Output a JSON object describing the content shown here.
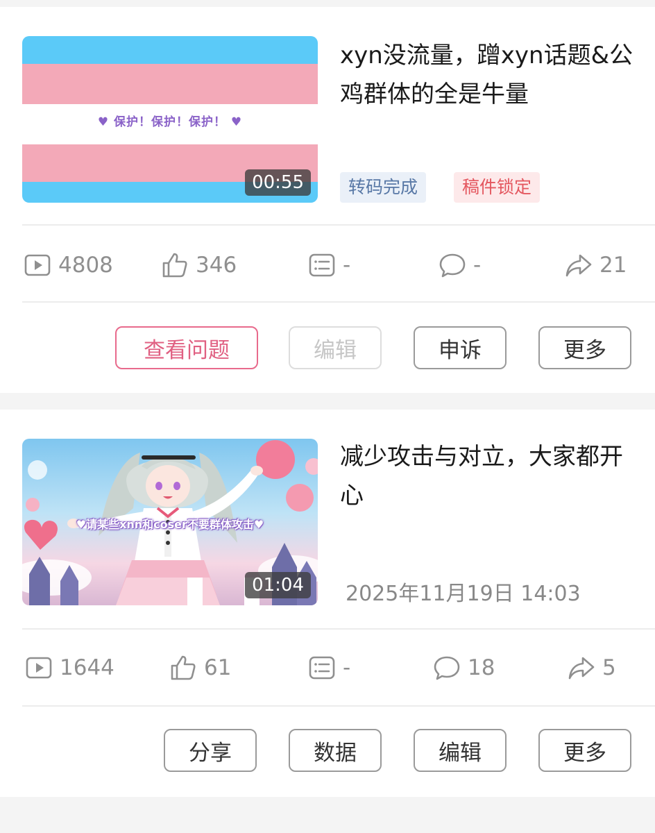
{
  "videos": [
    {
      "title": "xyn没流量，蹭xyn话题&公鸡群体的全是牛量",
      "thumbnail_caption": "♥ 保护！保护！保护！ ♥",
      "duration": "00:55",
      "tags": [
        "转码完成",
        "稿件锁定"
      ],
      "stats": {
        "plays": "4808",
        "likes": "346",
        "danmaku": "-",
        "comments": "-",
        "shares": "21"
      },
      "buttons": [
        "查看问题",
        "编辑",
        "申诉",
        "更多"
      ]
    },
    {
      "title": "减少攻击与对立，大家都开心",
      "thumbnail_caption": "♥请某些xnn和coser不要群体攻击♥",
      "duration": "01:04",
      "date": "2025年11月19日 14:03",
      "stats": {
        "plays": "1644",
        "likes": "61",
        "danmaku": "-",
        "comments": "18",
        "shares": "5"
      },
      "buttons": [
        "分享",
        "数据",
        "编辑",
        "更多"
      ]
    }
  ],
  "colors": {
    "primary_button": "#e86a8c",
    "tag_blue_text": "#5878a6",
    "tag_red_text": "#e4575f",
    "flag_blue": "#5bcaf8",
    "flag_pink": "#f3a9b8"
  },
  "icons": [
    "play-count-icon",
    "like-icon",
    "danmaku-icon",
    "comment-icon",
    "share-icon"
  ]
}
